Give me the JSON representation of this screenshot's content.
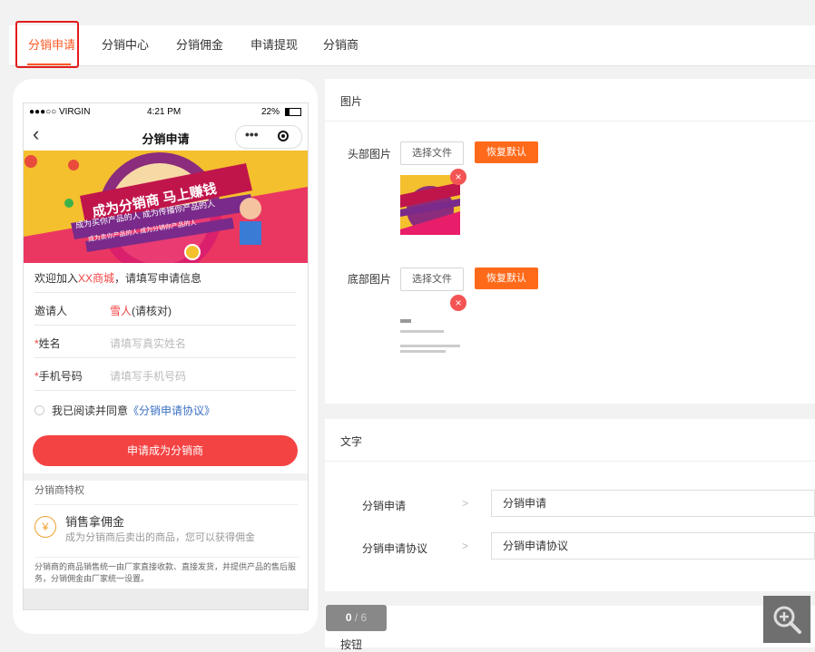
{
  "tabs": [
    {
      "label": "分销申请",
      "active": true
    },
    {
      "label": "分销中心",
      "active": false
    },
    {
      "label": "分销佣金",
      "active": false
    },
    {
      "label": "申请提现",
      "active": false
    },
    {
      "label": "分销商",
      "active": false
    }
  ],
  "phone": {
    "status": {
      "carrier": "●●●○○ VIRGIN",
      "time": "4:21 PM",
      "battery": "22%"
    },
    "nav_title": "分销申请",
    "banner": {
      "line1": "成为分销商  马上赚钱",
      "line2": "成为买你产品的人 成为传播你产品的人",
      "line3": "成为卖你产品的人 成为分销你产品的人"
    },
    "welcome": {
      "prefix": "欢迎加入",
      "shop": "XX商城",
      "suffix": "，请填写申请信息"
    },
    "fields": [
      {
        "label": "邀请人",
        "required": false,
        "value": "雪人",
        "note": "(请核对)"
      },
      {
        "label": "姓名",
        "required": true,
        "placeholder": "请填写真实姓名"
      },
      {
        "label": "手机号码",
        "required": true,
        "placeholder": "请填写手机号码"
      }
    ],
    "agree": {
      "text": "我已阅读并同意",
      "link": "《分销申请协议》"
    },
    "submit_label": "申请成为分销商",
    "privilege": {
      "title": "分销商特权",
      "item_title": "销售拿佣金",
      "item_desc": "成为分销商后卖出的商品，您可以获得佣金",
      "note": "分销商的商品销售统一由厂家直接收款、直接发货，并提供产品的售后服务，分销佣金由厂家统一设置。"
    }
  },
  "image_panel": {
    "title": "图片",
    "rows": [
      {
        "label": "头部图片",
        "choose": "选择文件",
        "reset": "恢复默认"
      },
      {
        "label": "底部图片",
        "choose": "选择文件",
        "reset": "恢复默认"
      }
    ],
    "delete_symbol": "×"
  },
  "text_panel": {
    "title": "文字",
    "rows": [
      {
        "label": "分销申请",
        "value": "分销申请"
      },
      {
        "label": "分销申请协议",
        "value": "分销申请协议"
      }
    ]
  },
  "button_panel": {
    "title": "按钮"
  },
  "pager": {
    "current": "0",
    "total": "/ 6"
  },
  "colors": {
    "accent": "#ff5722",
    "reset_button": "#ff6a1a",
    "submit": "#f44343",
    "delete": "#f45454",
    "highlight_box": "#e31c1c",
    "banner_bg": "#f4c02e"
  }
}
